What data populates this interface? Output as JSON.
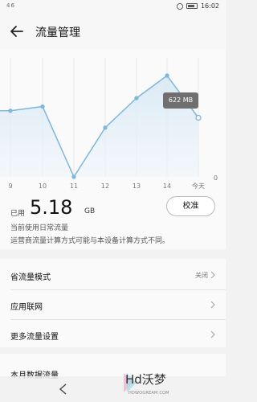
{
  "status": {
    "signal": "46",
    "time": "16:02"
  },
  "header": {
    "title": "流量管理"
  },
  "chart_data": {
    "type": "line",
    "categories": [
      "9",
      "10",
      "11",
      "12",
      "13",
      "14",
      "今天"
    ],
    "values": [
      470,
      500,
      0,
      350,
      560,
      720,
      420
    ],
    "ylim": [
      0,
      800
    ],
    "y_tick_labels": [
      "0"
    ],
    "annotation": "622 MB",
    "color": "#7fb6dc"
  },
  "usage": {
    "label": "已用",
    "value": "5.18",
    "unit": "GB"
  },
  "calibrate": {
    "label": "校准"
  },
  "notes": {
    "line1": "当前使用日常流量",
    "line2": "运营商流量计算方式可能与本设备计算方式不同。"
  },
  "settings": [
    {
      "label": "省流量模式",
      "value": "关闭"
    },
    {
      "label": "应用联网",
      "value": ""
    },
    {
      "label": "更多流量设置",
      "value": ""
    }
  ],
  "section": {
    "title": "本月数据流量"
  },
  "watermark": {
    "title": "Hd沃梦",
    "subtitle": "HDWOGREAM.COM"
  }
}
